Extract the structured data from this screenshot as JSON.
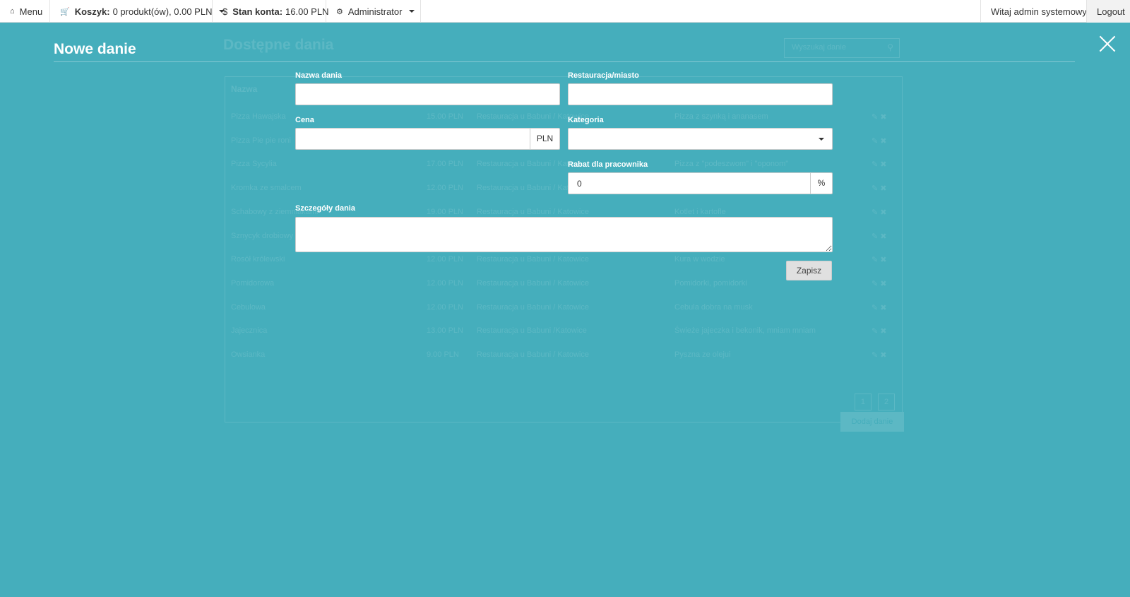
{
  "navbar": {
    "menu": "Menu",
    "cart_label": "Koszyk:",
    "cart_value": "0 produkt(ów), 0.00 PLN",
    "balance_label": "Stan konta:",
    "balance_value": "16.00 PLN",
    "admin": "Administrator",
    "greeting": "Witaj admin systemowy",
    "logout": "Logout"
  },
  "background": {
    "title": "Dostępne dania",
    "search_placeholder": "Wyszukaj danie",
    "header_name": "Nazwa",
    "rows": [
      {
        "name": "Pizza Hawajska",
        "price": "15.00 PLN",
        "restaurant": "Restauracja u Babuni / Katowice",
        "desc": "Pizza z szynką i ananasem"
      },
      {
        "name": "Pizza Pie pie roni",
        "price": "",
        "restaurant": "",
        "desc": ""
      },
      {
        "name": "Pizza Sycylia",
        "price": "17.00 PLN",
        "restaurant": "Restauracja u Babuni / Katowice",
        "desc": "Pizza z \"podeszwom\" i \"oponom\""
      },
      {
        "name": "Kromka ze smalcem",
        "price": "12.00 PLN",
        "restaurant": "Restauracja u Babuni / Katowice",
        "desc": ""
      },
      {
        "name": "Schabowy z ziemniakami",
        "price": "19.00 PLN",
        "restaurant": "Restauracja u Babuni / Katowice",
        "desc": "Kotlet i kartofle"
      },
      {
        "name": "Sznycyk drobiowy",
        "price": "",
        "restaurant": "",
        "desc": ""
      },
      {
        "name": "Rosół królewski",
        "price": "12.00 PLN",
        "restaurant": "Restauracja u Babuni / Katowice",
        "desc": "Kura w wodzie"
      },
      {
        "name": "Pomidorowa",
        "price": "12.00 PLN",
        "restaurant": "Restauracja u Babuni / Katowice",
        "desc": "Pomidorki, pomidorki"
      },
      {
        "name": "Cebulowa",
        "price": "12.00 PLN",
        "restaurant": "Restauracja u Babuni / Katowice",
        "desc": "Cebula dobra na musk"
      },
      {
        "name": "Jajecznica",
        "price": "13.00 PLN",
        "restaurant": "Restauracja u Babuni /Katowice",
        "desc": "Świeże jajeczka i bekonik, mniam mniam"
      },
      {
        "name": "Owsianka",
        "price": "9.00 PLN",
        "restaurant": "Restauracja u Babuni / Katowice",
        "desc": "Pysznа ze olejui"
      }
    ],
    "pages": [
      "1",
      "2"
    ],
    "add_button": "Dodaj danie"
  },
  "modal": {
    "title": "Nowe danie",
    "fields": {
      "name_label": "Nazwa dania",
      "name_value": "",
      "restaurant_label": "Restauracja/miasto",
      "restaurant_value": "",
      "price_label": "Cena",
      "price_value": "",
      "price_unit": "PLN",
      "category_label": "Kategoria",
      "category_value": "",
      "discount_label": "Rabat dla pracownika",
      "discount_value": "0",
      "discount_unit": "%",
      "details_label": "Szczegóły dania",
      "details_value": ""
    },
    "save_button": "Zapisz"
  },
  "icons": {
    "menu": "home-icon",
    "cart": "cart-icon",
    "balance": "dollar-icon",
    "admin": "cogs-icon",
    "close": "close-icon"
  }
}
